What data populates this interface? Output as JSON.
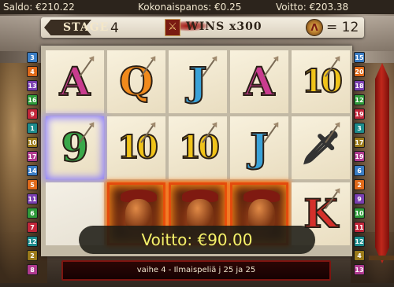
{
  "status_bar": {
    "balance": "Saldo: €210.22",
    "total_bet": "Kokonaispanos: €0.25",
    "win": "Voitto: €203.38"
  },
  "info_bar": {
    "stage_label": "STAGE",
    "stage_value": "4",
    "wins_label": "WINS x300",
    "shield_count": "= 12"
  },
  "paylines_left": [
    "3",
    "4",
    "13",
    "16",
    "9",
    "1",
    "10",
    "17",
    "14",
    "5",
    "11",
    "6",
    "7",
    "12",
    "2",
    "8"
  ],
  "paylines_right": [
    "15",
    "20",
    "18",
    "12",
    "19",
    "3",
    "17",
    "19",
    "6",
    "2",
    "9",
    "10",
    "11",
    "12",
    "4",
    "13"
  ],
  "reels": [
    [
      "A",
      "Q",
      "J",
      "A",
      "10"
    ],
    [
      "9",
      "10",
      "10",
      "J",
      "sword"
    ],
    [
      "",
      "spartan",
      "spartan",
      "spartan",
      "K"
    ]
  ],
  "symbol_colors": {
    "A": "#c93c8f",
    "Q": "#f08a1c",
    "J": "#3aa2d8",
    "10": "#f0c31a",
    "9": "#3aa84a",
    "K": "#d4302b"
  },
  "win_message": "Voitto: €90.00",
  "bottom_message": "vaihe 4 - Ilmaispeliä j 25 ja 25"
}
